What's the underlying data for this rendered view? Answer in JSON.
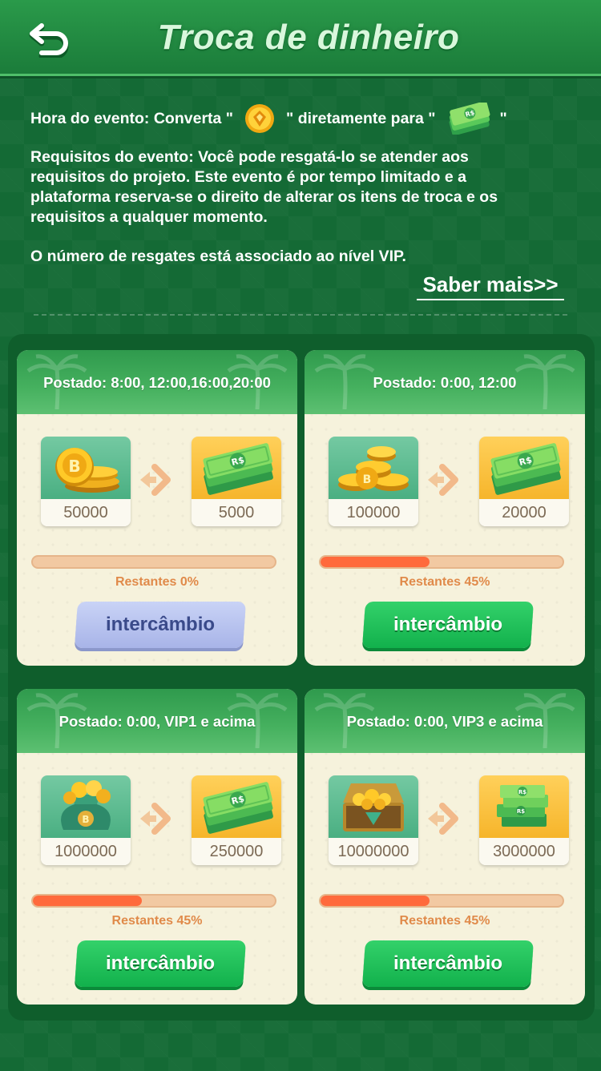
{
  "header": {
    "title": "Troca  de dinheiro",
    "back_icon": "back-arrow-icon"
  },
  "info": {
    "event_time_prefix": "Hora do evento: Converta \"",
    "event_time_middle": "\" diretamente para \"",
    "event_time_suffix": "\"",
    "requirements_line1": "Requisitos do evento: Você pode resgatá-lo se atender aos",
    "requirements_line2": "requisitos do projeto. Este evento é por tempo limitado e a",
    "requirements_line3": "plataforma reserva-se o direito de alterar os itens de troca e os",
    "requirements_line4": "requisitos a qualquer momento.",
    "vip_note": "O número de resgates está associado ao nível VIP.",
    "learn_more": "Saber mais>>"
  },
  "cards": [
    {
      "title": "Postado: 8:00, 12:00,16:00,20:00",
      "from_value": "50000",
      "to_value": "5000",
      "remaining_label": "Restantes 0%",
      "progress_percent": 0,
      "button_label": "intercâmbio",
      "button_state": "disabled"
    },
    {
      "title": "Postado: 0:00, 12:00",
      "from_value": "100000",
      "to_value": "20000",
      "remaining_label": "Restantes 45%",
      "progress_percent": 45,
      "button_label": "intercâmbio",
      "button_state": "active"
    },
    {
      "title": "Postado: 0:00, VIP1 e acima",
      "from_value": "1000000",
      "to_value": "250000",
      "remaining_label": "Restantes 45%",
      "progress_percent": 45,
      "button_label": "intercâmbio",
      "button_state": "active"
    },
    {
      "title": "Postado: 0:00, VIP3 e acima",
      "from_value": "10000000",
      "to_value": "3000000",
      "remaining_label": "Restantes 45%",
      "progress_percent": 45,
      "button_label": "intercâmbio",
      "button_state": "active"
    }
  ],
  "colors": {
    "background": "#146a35",
    "active_button": "#12b14c",
    "disabled_button": "#a8b4e8",
    "progress_fill": "#ff6a3c"
  }
}
